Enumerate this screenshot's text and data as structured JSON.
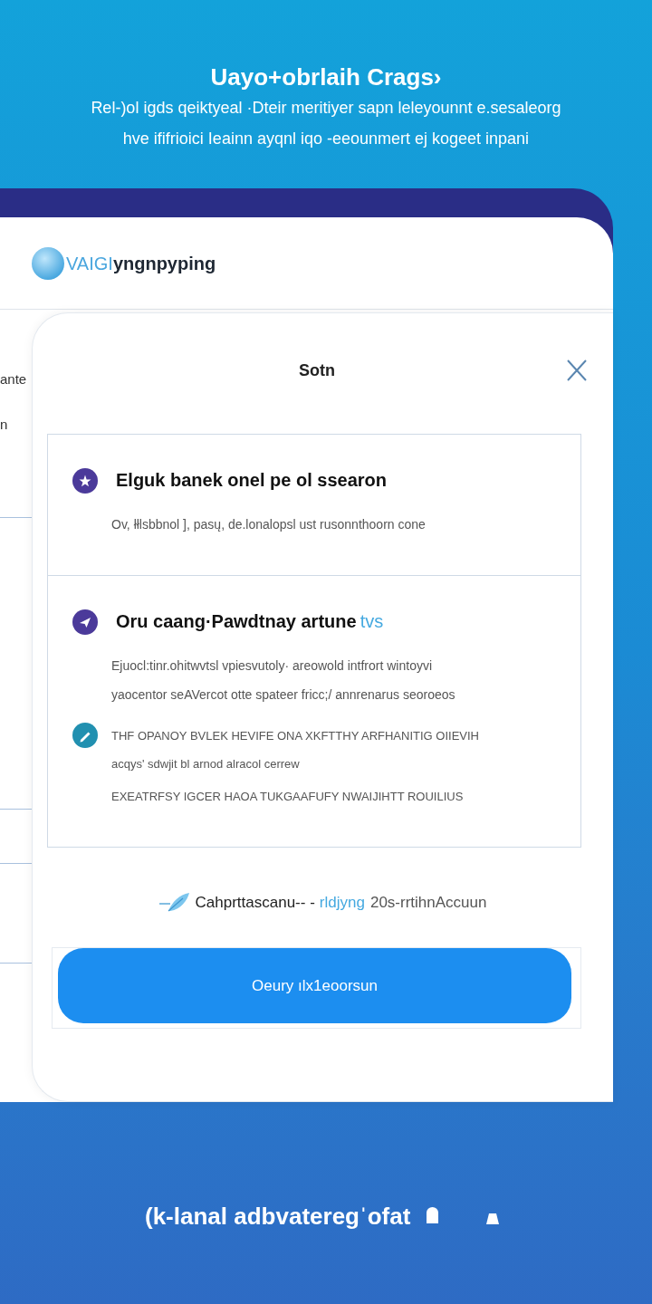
{
  "header": {
    "title": "Uayo+obrlaih Crags›",
    "subtitle": [
      "Rel-)ol igds qeiktyeal ·Dteir meritiyer sapn leleyounnt e.sesaleorg",
      "hve ififrioici Ieainn ayqnl iqo -eeounmert ej kogeet inpani"
    ]
  },
  "app": {
    "logo": {
      "accent": "VAIGI",
      "name": "yngnpyping"
    },
    "background_labels": [
      "ante",
      "n"
    ]
  },
  "dialog": {
    "title": "Sotn",
    "sections": [
      {
        "items": [
          {
            "kind": "titled",
            "color": "#4b3a9a",
            "title": "Elguk banek onel pe ol ssearon",
            "description": [
              "Ov, łłlsbbnol ], pasų, de.lonalopsl ust rusonnthoorn cone"
            ]
          }
        ]
      },
      {
        "items": [
          {
            "kind": "titled",
            "color": "#4b3a9a",
            "title": "Oru caang·Pawdtnay artune",
            "title_tag": "tvs",
            "description": [
              "Ejuocl:tinr.ohitwvtsl vpiesvutoly· areowold intfrort wintoyvi",
              "yaocentor seAVercot otte spateer fricc;/ annrenarus seoroeos"
            ]
          },
          {
            "kind": "note",
            "color": "#2190b0",
            "paragraphs": [
              [
                "THF OPANOY BVLEK HEVIFE ONA XKFTTHY ARFHANITIG OIIEVIH",
                "acqys' sdwjit bl arnod alracol cerrew"
              ],
              [
                "EXEATRFSY IGCER HAOA TUKGAAFUFY NWAIJIHTT ROUILIUS"
              ]
            ]
          }
        ]
      }
    ],
    "link": {
      "text": "Cahprttascanu-- -",
      "highlight": "rldjyng",
      "suffix": "20s-rrtihnAccuun"
    },
    "button": {
      "label": "Oeury ılx1eoorsun"
    }
  },
  "footer": {
    "text": "(k-lanal adbvateregˈofat"
  }
}
